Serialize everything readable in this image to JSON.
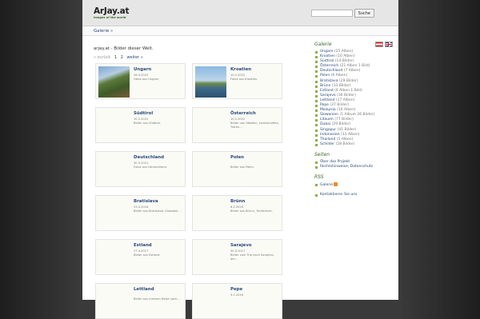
{
  "header": {
    "site_title": "ArJay.at",
    "tagline": "images of the world",
    "search_placeholder": "",
    "search_button": "Suche"
  },
  "breadcrumb": {
    "item": "Galerie »"
  },
  "main": {
    "intro": "arjay.at - Bilder dieser Welt.",
    "pager": {
      "prev": "« zurück",
      "pages": [
        "1",
        "2"
      ],
      "next": "weiter »"
    },
    "cards": [
      {
        "name": "Ungarn",
        "date": "26.4.2023",
        "desc": "Fotos aus Ungarn.",
        "thumb": "thumb-ungarn"
      },
      {
        "name": "Kroatien",
        "date": "10.2.2022",
        "desc": "Fotos aus Kroatien.",
        "thumb": "thumb-kroatien"
      },
      {
        "name": "Südtirol",
        "date": "10.2.2022",
        "desc": "Bilder aus Südtirol.",
        "thumb": ""
      },
      {
        "name": "Österreich",
        "date": "10.2.2022",
        "desc": "Bilder von Städten, Landschaften, Tieren...",
        "thumb": ""
      },
      {
        "name": "Deutschland",
        "date": "30.5.2021",
        "desc": "Fotos aus Deutschland.",
        "thumb": ""
      },
      {
        "name": "Polen",
        "date": "",
        "desc": "Bilder aus Polen.",
        "thumb": ""
      },
      {
        "name": "Bratislava",
        "date": "23.4.2018",
        "desc": "Bilder aus Bratislava, Slowakei...",
        "thumb": ""
      },
      {
        "name": "Brünn",
        "date": "8.2.2018",
        "desc": "Bilder aus Brünn, Tschechien.",
        "thumb": ""
      },
      {
        "name": "Estland",
        "date": "27.4.2017",
        "desc": "Bilder aus Estland.",
        "thumb": ""
      },
      {
        "name": "Sarajevo",
        "date": "30.5.2017",
        "desc": "Bilder vom Trip nach Sarajevo, der...",
        "thumb": ""
      },
      {
        "name": "Lettland",
        "date": "",
        "desc": "Bilder aus meinem Reise nach...",
        "thumb": ""
      },
      {
        "name": "Pepe",
        "date": "3.1.2016",
        "desc": "",
        "thumb": ""
      }
    ]
  },
  "sidebar": {
    "galerie_head": "Galerie",
    "flags": [
      "flag-at-icon",
      "flag-uk-icon"
    ],
    "galerie_items": [
      {
        "label": "Ungarn",
        "count": "(25 Alben)"
      },
      {
        "label": "Kroatien",
        "count": "(10 Alben)"
      },
      {
        "label": "Südtirol",
        "count": "(14 Bilder)"
      },
      {
        "label": "Österreich",
        "count": "(21 Alben 1 Bild)"
      },
      {
        "label": "Deutschland",
        "count": "(7 Alben)"
      },
      {
        "label": "Polen",
        "count": "(6 Alben)"
      },
      {
        "label": "Bratislava",
        "count": "(29 Bilder)"
      },
      {
        "label": "Brünn",
        "count": "(33 Bilder)"
      },
      {
        "label": "Estland",
        "count": "(6 Alben 1 Bild)"
      },
      {
        "label": "Sarajevo",
        "count": "(36 Bilder)"
      },
      {
        "label": "Lettland",
        "count": "(17 Alben)"
      },
      {
        "label": "Pepe",
        "count": "(37 Bilder)"
      },
      {
        "label": "Malaysia",
        "count": "(16 Alben)"
      },
      {
        "label": "Slowenien",
        "count": "(1 Album 26 Bilder)"
      },
      {
        "label": "Litauen",
        "count": "(77 Bilder)"
      },
      {
        "label": "Dubai",
        "count": "(29 Bilder)"
      },
      {
        "label": "Singapur",
        "count": "(41 Bilder)"
      },
      {
        "label": "Indonesien",
        "count": "(13 Alben)"
      },
      {
        "label": "Thailand",
        "count": "(5 Alben)"
      },
      {
        "label": "Schilder",
        "count": "(28 Bilder)"
      }
    ],
    "seiten_head": "Seiten",
    "seiten_items": [
      {
        "label": "Über das Projekt"
      },
      {
        "label": "Rechtshinweise, Datenschutz"
      }
    ],
    "rss_head": "RSS",
    "rss_items": [
      {
        "label": "Galerie",
        "icon": "rss-icon"
      }
    ],
    "contact_items": [
      {
        "label": "Kontaktieren Sie uns"
      }
    ]
  }
}
